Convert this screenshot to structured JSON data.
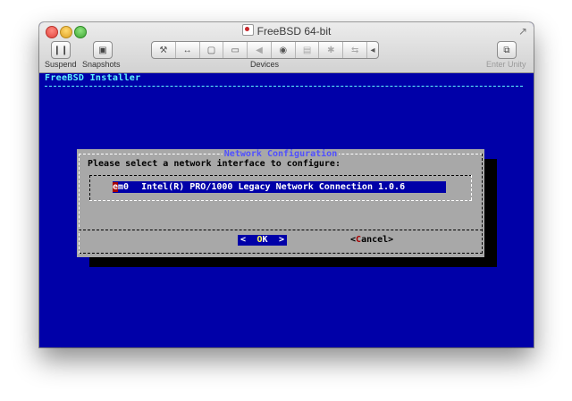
{
  "window": {
    "title": "FreeBSD 64-bit"
  },
  "toolbar": {
    "suspend_label": "Suspend",
    "snapshots_label": "Snapshots",
    "devices_label": "Devices",
    "enter_unity_label": "Enter Unity",
    "suspend_icon": "pause-icon",
    "snapshots_icon": "snapshot-icon",
    "enter_unity_icon": "windows-overlap-icon",
    "device_icons": [
      "wrench-icon",
      "network-arrows-icon",
      "disk-icon",
      "hard-drive-icon",
      "speaker-icon",
      "camera-icon",
      "printer-icon",
      "bluetooth-icon",
      "usb-icon",
      "chevron-left-icon"
    ]
  },
  "installer": {
    "title": "FreeBSD Installer"
  },
  "dialog": {
    "title": "Network Configuration",
    "prompt": "Please select a network interface to configure:",
    "interface_name_first": "e",
    "interface_name_rest": "m0",
    "interface_desc": "Intel(R) PRO/1000 Legacy Network Connection 1.0.6",
    "ok_left": "<",
    "ok_hot": "O",
    "ok_rest": "K",
    "ok_right": ">",
    "cancel_open": "<",
    "cancel_hot": "C",
    "cancel_rest": "ancel",
    "cancel_close": ">"
  },
  "colors": {
    "screen_bg": "#0000a8",
    "dialog_bg": "#a8a8a8",
    "title_cyan": "#5ff5ff",
    "dialog_title": "#5050ff",
    "hotkey_red": "#a80000",
    "hotkey_yellow": "#ffff55"
  }
}
